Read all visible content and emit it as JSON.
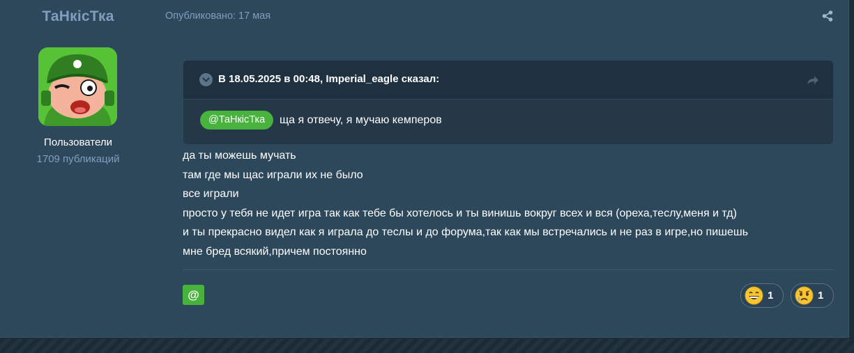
{
  "author": {
    "name": "ТаНкісТка",
    "group": "Пользователи",
    "posts": "1709 публикаций"
  },
  "post": {
    "meta": "Опубликовано: 17 мая",
    "quote": {
      "citation": "В 18.05.2025 в 00:48, Imperial_eagle сказал:",
      "mention": "@ТаНкісТка",
      "text": "ща я отвечу, я мучаю кемперов"
    },
    "body": [
      "да ты можешь мучать",
      "там где мы щас играли их не было",
      "все играли",
      "просто у тебя не идет игра так как тебе бы хотелось и ты винишь вокруг всех и вся (ореха,теслу,меня и тд)",
      "и ты прекрасно видел как я играла до теслы и до форума,так как мы встречались и не раз в игре,но пишешь",
      "мне бред всякий,причем постоянно"
    ],
    "mention_button": "@",
    "reactions": [
      {
        "icon": "grinning-face-icon",
        "count": "1"
      },
      {
        "icon": "crying-face-icon",
        "count": "1"
      }
    ]
  },
  "colors": {
    "background": "#2d475b",
    "muted_text": "#7f9fc0",
    "accent_green": "#47b33d",
    "quote_bg": "#243847"
  }
}
